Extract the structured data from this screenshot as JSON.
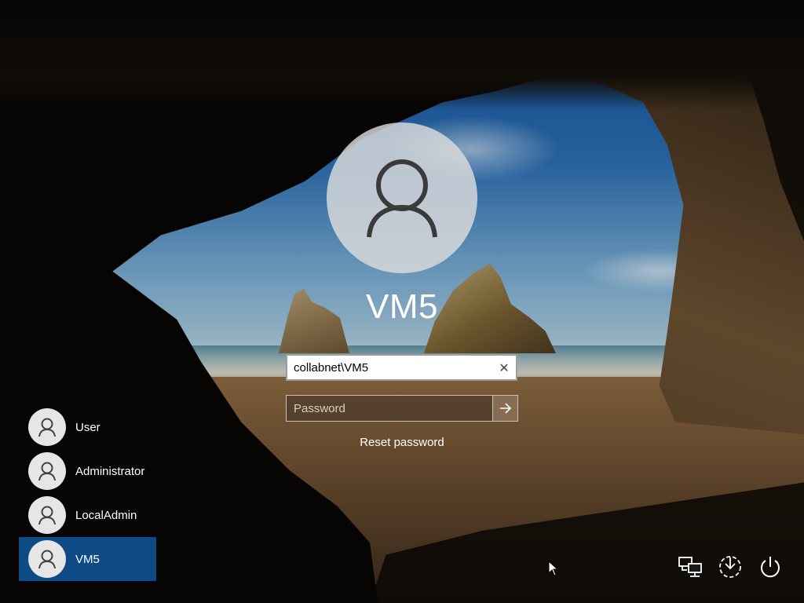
{
  "login": {
    "display_name": "VM5",
    "username_value": "collabnet\\VM5",
    "password_placeholder": "Password",
    "reset_password": "Reset password"
  },
  "users": [
    {
      "label": "User",
      "selected": false
    },
    {
      "label": "Administrator",
      "selected": false
    },
    {
      "label": "LocalAdmin",
      "selected": false
    },
    {
      "label": "VM5",
      "selected": true
    }
  ],
  "tray": {
    "icons": [
      "network-icon",
      "ease-of-access-icon",
      "power-icon"
    ]
  },
  "colors": {
    "selected_user_bg": "#0e4a86",
    "avatar_bg": "#e6e6e6"
  }
}
